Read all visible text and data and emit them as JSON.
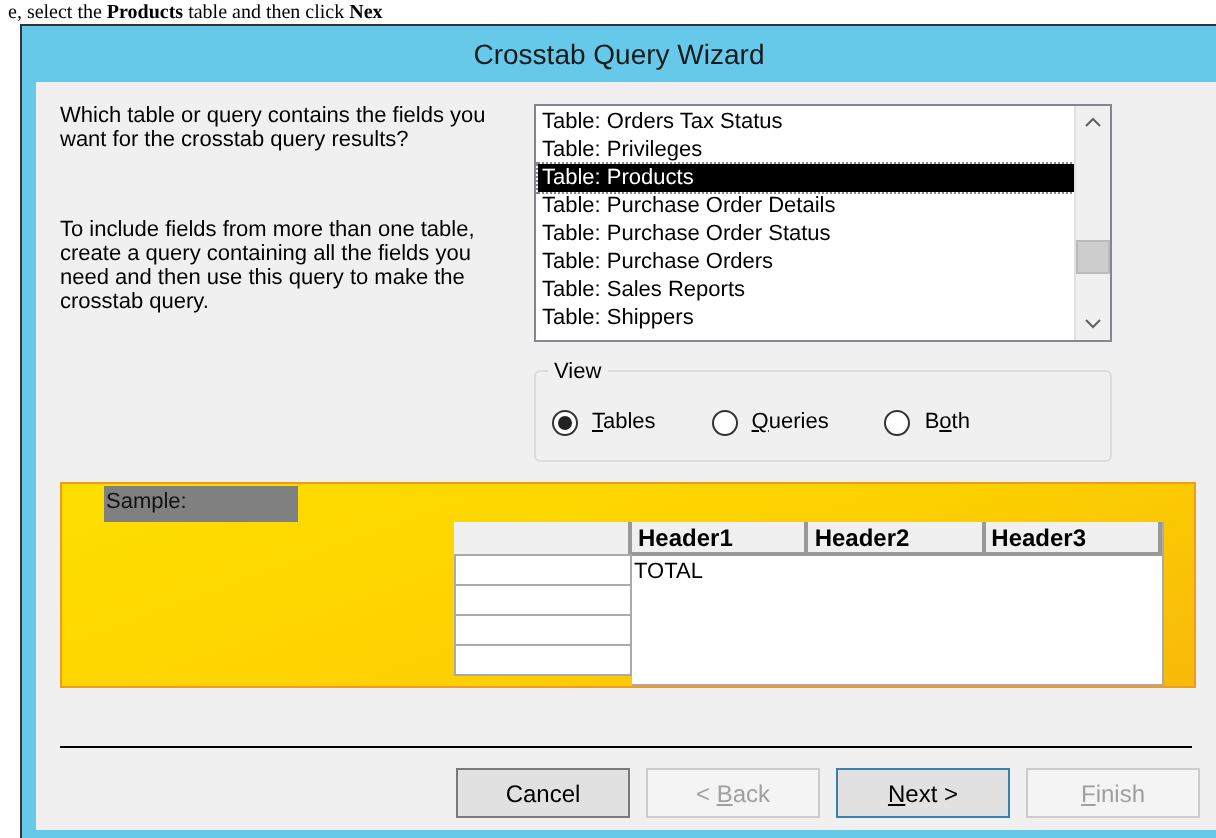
{
  "caption": "e, select the **Products** table and then click **Nex**",
  "window": {
    "title": "Crosstab Query Wizard"
  },
  "instructions": [
    "Which table or query contains the fields you want for the crosstab query results?",
    "To include fields from more than one table, create a query containing all the fields you need and then use this query to make the crosstab query."
  ],
  "table_list": [
    {
      "label": "Table: Orders Tax Status",
      "selected": false
    },
    {
      "label": "Table: Privileges",
      "selected": false
    },
    {
      "label": "Table: Products",
      "selected": true
    },
    {
      "label": "Table: Purchase Order Details",
      "selected": false
    },
    {
      "label": "Table: Purchase Order Status",
      "selected": false
    },
    {
      "label": "Table: Purchase Orders",
      "selected": false
    },
    {
      "label": "Table: Sales Reports",
      "selected": false
    },
    {
      "label": "Table: Shippers",
      "selected": false
    }
  ],
  "view": {
    "legend": "View",
    "options": [
      {
        "key": "T",
        "after": "ables",
        "selected": true
      },
      {
        "key": "Q",
        "after": "ueries",
        "selected": false
      },
      {
        "before": "B",
        "key": "o",
        "after": "th",
        "selected": false
      }
    ]
  },
  "sample": {
    "label": "Sample:",
    "columns": [
      "Header1",
      "Header2",
      "Header3"
    ],
    "total_label": "TOTAL"
  },
  "buttons": [
    {
      "before": "Cancel",
      "disabled": false,
      "default": false
    },
    {
      "before": "< ",
      "key": "B",
      "after": "ack",
      "disabled": true,
      "default": false
    },
    {
      "key": "N",
      "after": "ext >",
      "disabled": false,
      "default": true
    },
    {
      "key": "F",
      "after": "inish",
      "disabled": true,
      "default": false
    }
  ]
}
